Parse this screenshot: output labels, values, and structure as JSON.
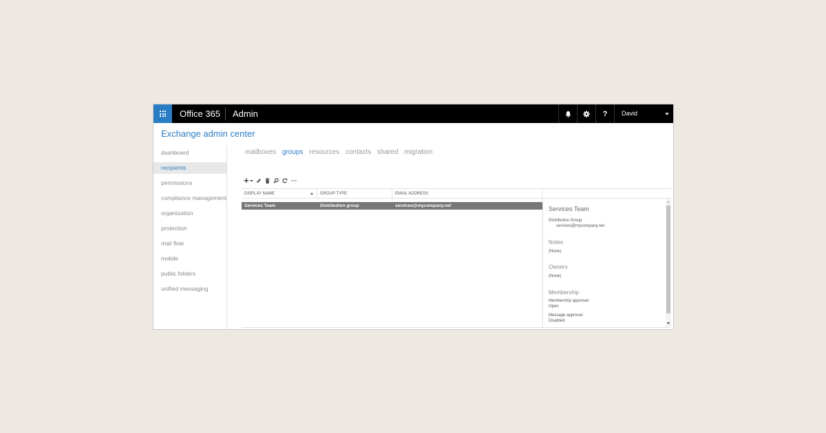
{
  "header": {
    "brand": "Office 365",
    "app": "Admin",
    "user": "David",
    "help_label": "?"
  },
  "eac_title": "Exchange admin center",
  "nav": {
    "items": [
      {
        "label": "dashboard"
      },
      {
        "label": "recipients",
        "active": true
      },
      {
        "label": "permissions"
      },
      {
        "label": "compliance management"
      },
      {
        "label": "organization"
      },
      {
        "label": "protection"
      },
      {
        "label": "mail flow"
      },
      {
        "label": "mobile"
      },
      {
        "label": "public folders"
      },
      {
        "label": "unified messaging"
      }
    ]
  },
  "tabs": [
    {
      "label": "mailboxes"
    },
    {
      "label": "groups",
      "active": true
    },
    {
      "label": "resources"
    },
    {
      "label": "contacts"
    },
    {
      "label": "shared"
    },
    {
      "label": "migration"
    }
  ],
  "toolbar": {
    "icons": [
      "add-icon",
      "edit-icon",
      "delete-icon",
      "search-icon",
      "refresh-icon",
      "more-icon"
    ],
    "add_symbol": "+",
    "more_symbol": "···"
  },
  "grid": {
    "columns": [
      "DISPLAY NAME",
      "GROUP TYPE",
      "EMAIL ADDRESS"
    ],
    "rows": [
      {
        "display_name": "Services Team",
        "group_type": "Distribution group",
        "email": "services@mycompany.net"
      }
    ]
  },
  "details": {
    "title": "Services Team",
    "type": "Distribution Group",
    "email": "services@mycompany.net",
    "notes_heading": "Notes",
    "notes_value": "(None)",
    "owners_heading": "Owners",
    "owners_value": "(None)",
    "membership_heading": "Membership",
    "membership_approval_label": "Membership approval:",
    "membership_approval_value": "Open",
    "message_approval_label": "Message approval:",
    "message_approval_value": "Disabled"
  },
  "colors": {
    "accent": "#2a7dc4",
    "topbar": "#000000",
    "selected_row": "#767676",
    "page_bg": "#eee8e2"
  }
}
